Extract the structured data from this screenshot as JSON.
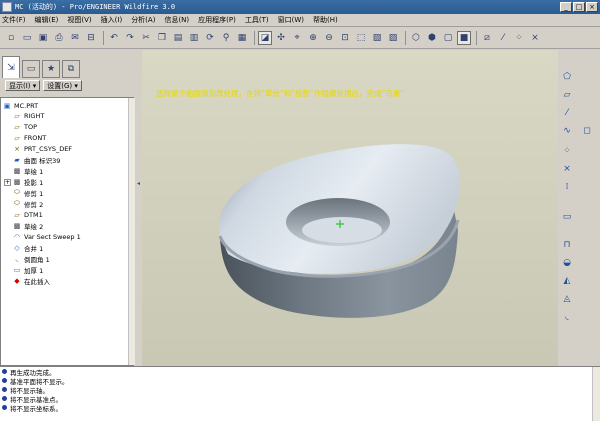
{
  "window": {
    "title": "MC (活动的) - Pro/ENGINEER Wildfire 3.0"
  },
  "menu": [
    "文件(F)",
    "编辑(E)",
    "视图(V)",
    "插入(I)",
    "分析(A)",
    "信息(N)",
    "应用程序(P)",
    "工具(T)",
    "窗口(W)",
    "帮助(H)"
  ],
  "panel": {
    "display_label": "显示(I)",
    "settings_label": "设置(G)"
  },
  "tree": [
    {
      "label": "MC.PRT",
      "icon": "part-icon"
    },
    {
      "label": "RIGHT",
      "icon": "datum-plane-icon"
    },
    {
      "label": "TOP",
      "icon": "datum-plane-icon"
    },
    {
      "label": "FRONT",
      "icon": "datum-plane-icon"
    },
    {
      "label": "PRT_CSYS_DEF",
      "icon": "csys-icon"
    },
    {
      "label": "曲面 标识39",
      "icon": "surface-icon"
    },
    {
      "label": "草绘 1",
      "icon": "sketch-icon"
    },
    {
      "label": "投影 1",
      "icon": "projection-icon"
    },
    {
      "label": "修剪 1",
      "icon": "trim-icon"
    },
    {
      "label": "修剪 2",
      "icon": "trim-icon"
    },
    {
      "label": "DTM1",
      "icon": "datum-plane-icon"
    },
    {
      "label": "草绘 2",
      "icon": "sketch-icon"
    },
    {
      "label": "Var Sect Sweep 1",
      "icon": "sweep-icon"
    },
    {
      "label": "合并 1",
      "icon": "merge-icon"
    },
    {
      "label": "倒圆角 1",
      "icon": "round-icon"
    },
    {
      "label": "加厚 1",
      "icon": "thicken-icon"
    },
    {
      "label": "在此插入",
      "icon": "insert-here-icon"
    }
  ],
  "viewport": {
    "message": "选择整个曲面做加厚处理，在将“草绘”和“投影”作隐藏处理后，完成“鸟巢”"
  },
  "status": [
    "再生成功完成。",
    "基准平面将不显示。",
    "将不显示轴。",
    "将不显示基准点。",
    "将不显示坐标系。"
  ],
  "colors": {
    "message_yellow": "#e8d800",
    "viewport_bg": "#d0d0bc",
    "model": "#b8c2cc"
  }
}
